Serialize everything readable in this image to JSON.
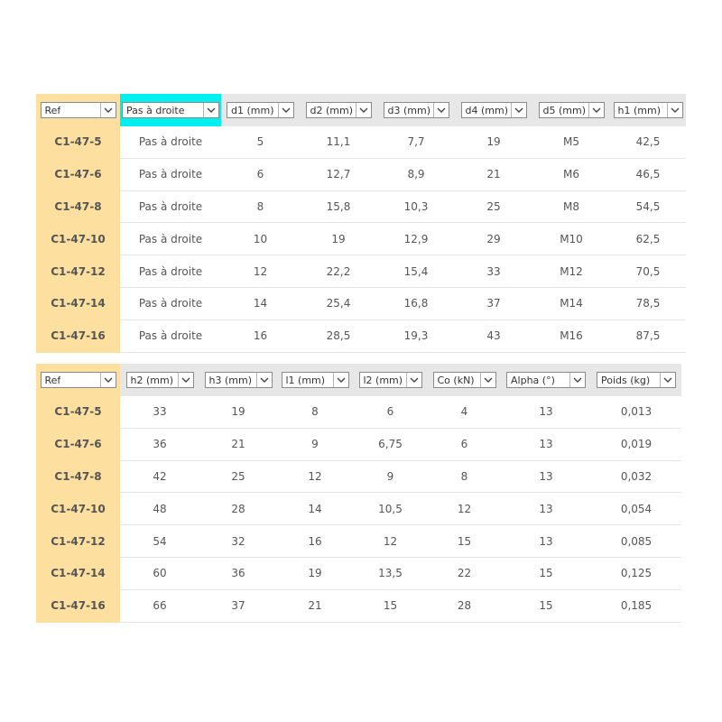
{
  "table1": {
    "headers": [
      "Ref",
      "Pas à droite",
      "d1 (mm)",
      "d2 (mm)",
      "d3 (mm)",
      "d4 (mm)",
      "d5 (mm)",
      "h1 (mm)"
    ],
    "rows": [
      [
        "C1-47-5",
        "Pas à droite",
        "5",
        "11,1",
        "7,7",
        "19",
        "M5",
        "42,5"
      ],
      [
        "C1-47-6",
        "Pas à droite",
        "6",
        "12,7",
        "8,9",
        "21",
        "M6",
        "46,5"
      ],
      [
        "C1-47-8",
        "Pas à droite",
        "8",
        "15,8",
        "10,3",
        "25",
        "M8",
        "54,5"
      ],
      [
        "C1-47-10",
        "Pas à droite",
        "10",
        "19",
        "12,9",
        "29",
        "M10",
        "62,5"
      ],
      [
        "C1-47-12",
        "Pas à droite",
        "12",
        "22,2",
        "15,4",
        "33",
        "M12",
        "70,5"
      ],
      [
        "C1-47-14",
        "Pas à droite",
        "14",
        "25,4",
        "16,8",
        "37",
        "M14",
        "78,5"
      ],
      [
        "C1-47-16",
        "Pas à droite",
        "16",
        "28,5",
        "19,3",
        "43",
        "M16",
        "87,5"
      ]
    ]
  },
  "table2": {
    "headers": [
      "Ref",
      "h2 (mm)",
      "h3 (mm)",
      "l1 (mm)",
      "l2 (mm)",
      "Co (kN)",
      "Alpha (°)",
      "Poids (kg)"
    ],
    "rows": [
      [
        "C1-47-5",
        "33",
        "19",
        "8",
        "6",
        "4",
        "13",
        "0,013"
      ],
      [
        "C1-47-6",
        "36",
        "21",
        "9",
        "6,75",
        "6",
        "13",
        "0,019"
      ],
      [
        "C1-47-8",
        "42",
        "25",
        "12",
        "9",
        "8",
        "13",
        "0,032"
      ],
      [
        "C1-47-10",
        "48",
        "28",
        "14",
        "10,5",
        "12",
        "13",
        "0,054"
      ],
      [
        "C1-47-12",
        "54",
        "32",
        "16",
        "12",
        "15",
        "13",
        "0,085"
      ],
      [
        "C1-47-14",
        "60",
        "36",
        "19",
        "13,5",
        "22",
        "15",
        "0,125"
      ],
      [
        "C1-47-16",
        "66",
        "37",
        "21",
        "15",
        "28",
        "15",
        "0,185"
      ]
    ]
  },
  "colors": {
    "ref_column": "#fde0a0",
    "active_filter_highlight": "#00f0f0",
    "header_background": "#e7e7e7"
  },
  "icons": {
    "dropdown": "chevron-down-icon"
  }
}
